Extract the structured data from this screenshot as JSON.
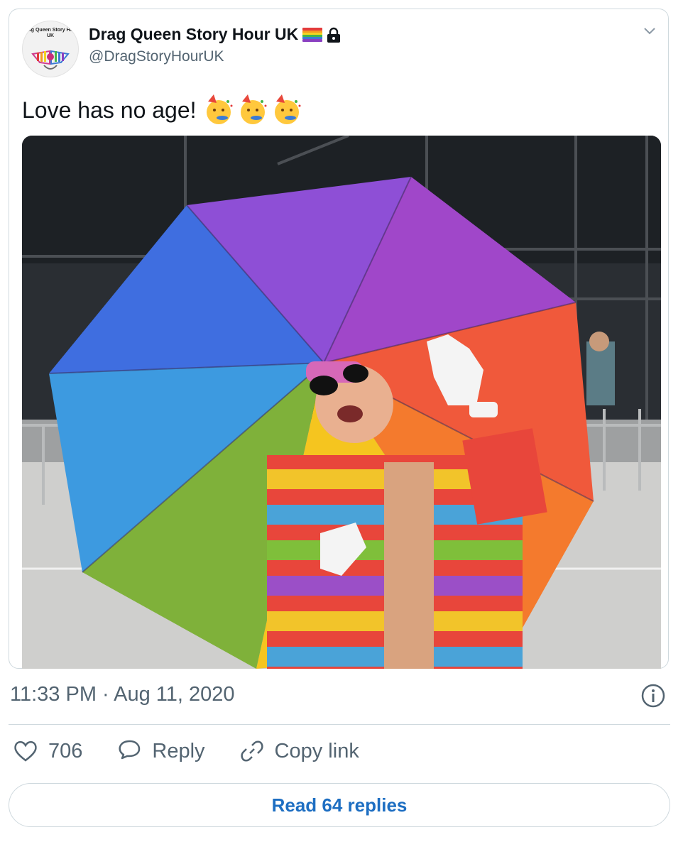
{
  "tweet": {
    "author_name": "Drag Queen Story Hour UK",
    "author_handle": "@DragStoryHourUK",
    "avatar_logo_text": "Drag Queen Story Hour UK",
    "name_icons": [
      "rainbow-flag-icon",
      "lock-icon"
    ],
    "text": "Love has no age!",
    "emojis": [
      "partying-face-emoji",
      "partying-face-emoji",
      "partying-face-emoji"
    ],
    "photo_description_icon": "photo",
    "timestamp": "11:33 PM · Aug 11, 2020"
  },
  "actions": {
    "like_count": "706",
    "reply_label": "Reply",
    "copy_link_label": "Copy link"
  },
  "read_replies_label": "Read 64 replies",
  "colors": {
    "accent": "#1d6ec2",
    "border": "#cfd9de",
    "secondary_text": "#536471"
  }
}
